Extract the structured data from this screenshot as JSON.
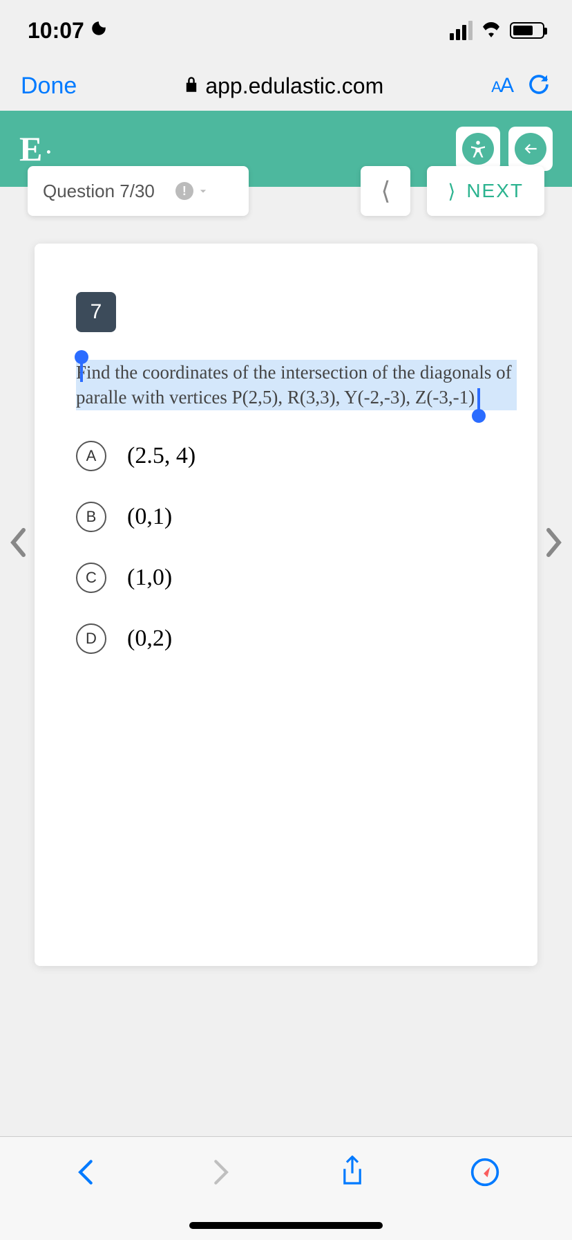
{
  "status": {
    "time": "10:07"
  },
  "browser": {
    "done": "Done",
    "url": "app.edulastic.com",
    "textSize": "AA"
  },
  "appHeader": {
    "logo": "E",
    "logoDot": "·"
  },
  "nav": {
    "questionLabel": "Question 7/30",
    "next": "NEXT"
  },
  "question": {
    "number": "7",
    "text": "Find the coordinates of the intersection of the diagonals of paralle with vertices P(2,5), R(3,3), Y(-2,-3), Z(-3,-1)",
    "highlightEndOffsetCh": 47
  },
  "answers": [
    {
      "letter": "A",
      "text": "(2.5, 4)"
    },
    {
      "letter": "B",
      "text": "(0,1)"
    },
    {
      "letter": "C",
      "text": "(1,0)"
    },
    {
      "letter": "D",
      "text": "(0,2)"
    }
  ]
}
